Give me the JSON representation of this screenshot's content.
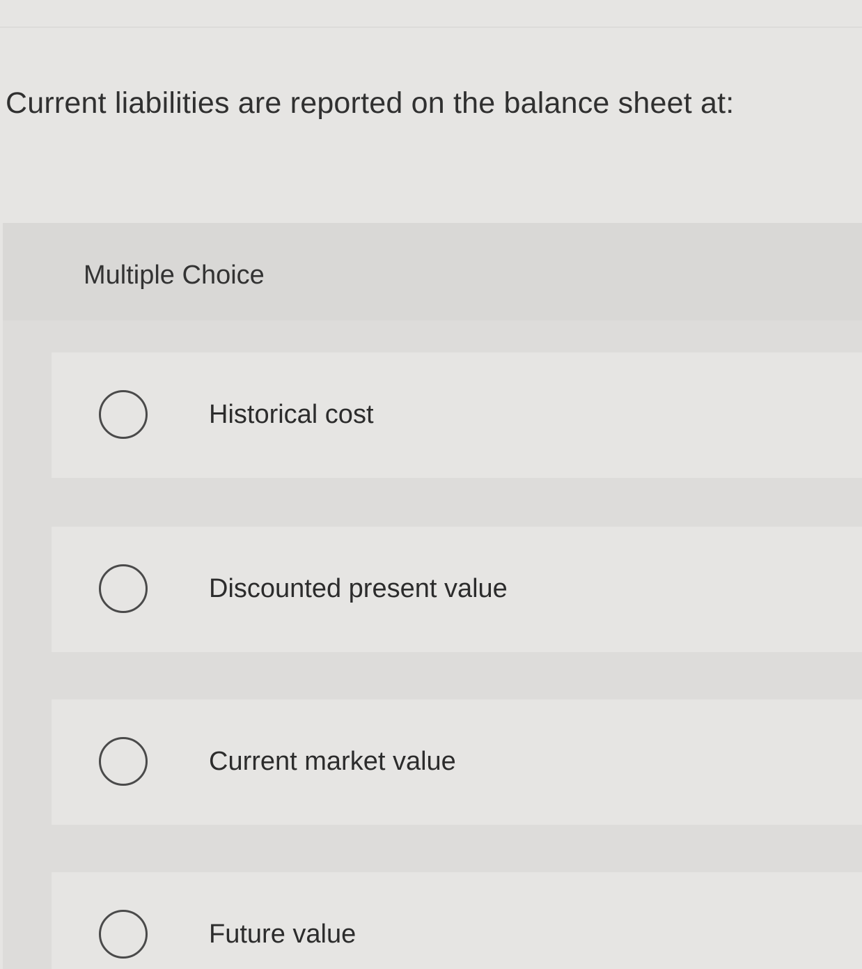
{
  "question": {
    "text": "Current liabilities are reported on the balance sheet at:"
  },
  "multiple_choice": {
    "label": "Multiple Choice",
    "options": [
      {
        "label": "Historical cost",
        "selected": false
      },
      {
        "label": "Discounted present value",
        "selected": false
      },
      {
        "label": "Current market value",
        "selected": false
      },
      {
        "label": "Future value",
        "selected": false
      }
    ]
  },
  "colors": {
    "page_background": "#e6e5e3",
    "panel_background": "#dddcda",
    "header_background": "#d9d8d6",
    "option_background": "#e6e5e3",
    "text": "#2e2e2e",
    "radio_border": "#4a4a4a"
  }
}
